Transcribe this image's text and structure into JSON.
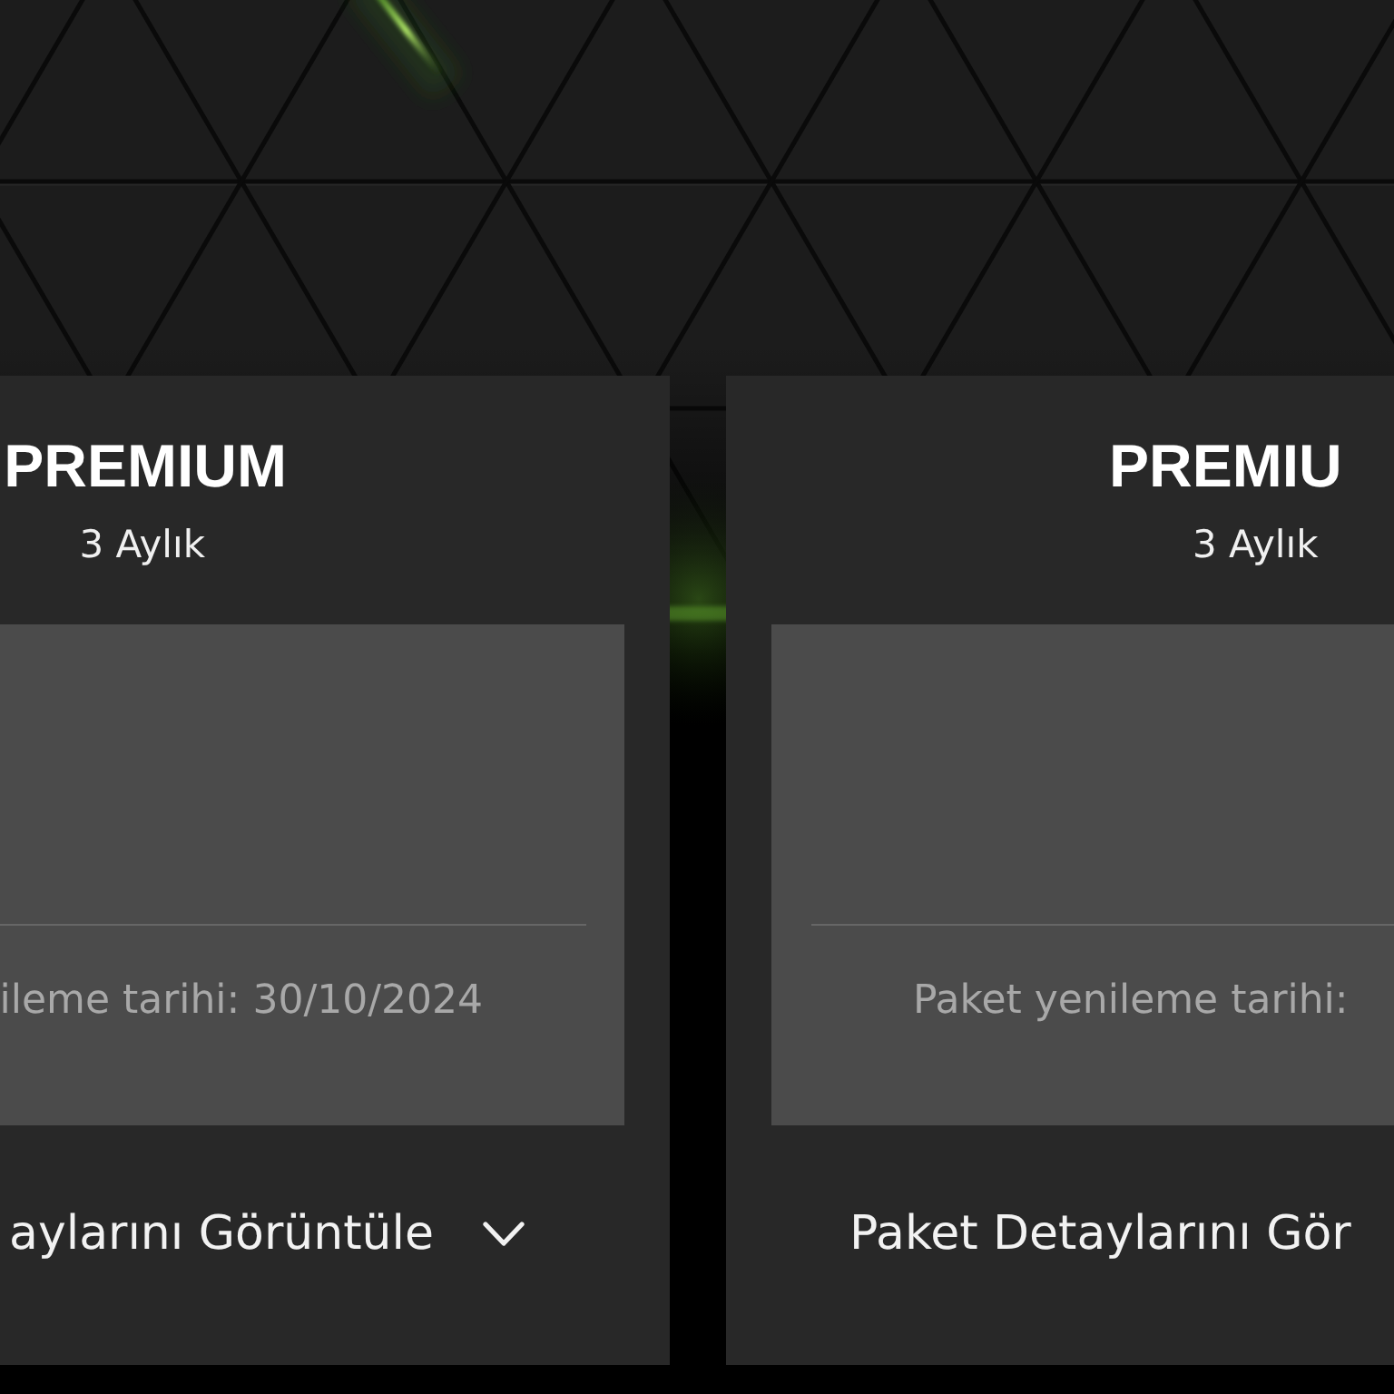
{
  "cards": [
    {
      "title": "PREMIUM",
      "period": "3 Aylık",
      "renewal_text": "ileme tarihi: 30/10/2024",
      "details_button": "aylarını Görüntüle"
    },
    {
      "title": "PREMIU",
      "period": "3 Aylık",
      "renewal_text": "Paket yenileme tarihi:",
      "details_button": "Paket Detaylarını Gör"
    }
  ]
}
